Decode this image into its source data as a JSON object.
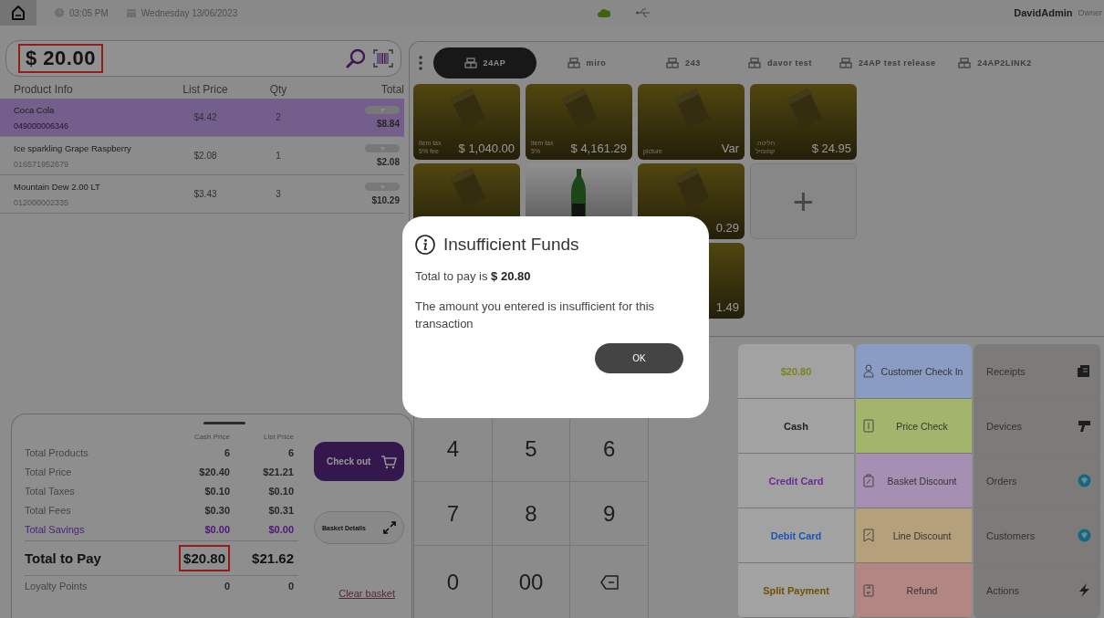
{
  "top_bar": {
    "time": "03:05 PM",
    "date": "Wednesday 13/06/2023",
    "user": "DavidAdmin",
    "role": "Owner"
  },
  "amount_field": {
    "value": "$ 20.00",
    "highlighted": true
  },
  "basket": {
    "columns": [
      "Product Info",
      "List Price",
      "Qty",
      "Total"
    ],
    "rows": [
      {
        "name": "Coca Cola",
        "code": "049000006346",
        "price": "$4.42",
        "qty": "2",
        "total": "$8.84",
        "selected": true
      },
      {
        "name": "Ice sparkling Grape Raspberry",
        "code": "016571952679",
        "price": "$2.08",
        "qty": "1",
        "total": "$2.08",
        "selected": false
      },
      {
        "name": "Mountain Dew 2.00 LT",
        "code": "012000002335",
        "price": "$3.43",
        "qty": "3",
        "total": "$10.29",
        "selected": false
      }
    ]
  },
  "summary": {
    "columns": [
      "Cash Price",
      "List Price"
    ],
    "rows": [
      {
        "kind": "plain",
        "label": "Total Products",
        "cash": "6",
        "list": "6"
      },
      {
        "kind": "plain",
        "label": "Total Price",
        "cash": "$20.40",
        "list": "$21.21"
      },
      {
        "kind": "plain",
        "label": "Total Taxes",
        "cash": "$0.10",
        "list": "$0.10"
      },
      {
        "kind": "plain",
        "label": "Total Fees",
        "cash": "$0.30",
        "list": "$0.31"
      },
      {
        "kind": "savings",
        "label": "Total Savings",
        "cash": "$0.00",
        "list": "$0.00"
      },
      {
        "kind": "total",
        "label": "Total to Pay",
        "cash": "$20.80",
        "list": "$21.62",
        "highlighted": true
      },
      {
        "kind": "plain",
        "label": "Loyalty Points",
        "cash": "0",
        "list": "0"
      }
    ],
    "checkout": "Check out",
    "basket_details": "Basket Details",
    "clear_basket": "Clear basket"
  },
  "categories": [
    {
      "label": "24AP",
      "selected": true
    },
    {
      "label": "miro",
      "selected": false
    },
    {
      "label": "243",
      "selected": false
    },
    {
      "label": "davor test",
      "selected": false
    },
    {
      "label": "24AP test release",
      "selected": false
    },
    {
      "label": "24AP2LINK2",
      "selected": false
    }
  ],
  "tile_rows": [
    [
      {
        "kind": "product",
        "lines": [
          "item tax",
          "5% fee"
        ],
        "price": "$ 1,040.00"
      },
      {
        "kind": "product",
        "lines": [
          "item tax",
          "5%"
        ],
        "price": "$ 4,161.29"
      },
      {
        "kind": "product",
        "lines": [
          "picture"
        ],
        "price": "Var"
      },
      {
        "kind": "product",
        "lines": [
          "חליטה",
          "קמומיל"
        ],
        "price": "$ 24.95"
      }
    ],
    [
      {
        "kind": "product"
      },
      {
        "kind": "bottle"
      },
      {
        "kind": "product",
        "price": "0.29"
      },
      {
        "kind": "add",
        "label": "+"
      }
    ],
    [
      {
        "kind": "blank"
      },
      {
        "kind": "blank"
      },
      {
        "kind": "covered",
        "price": "1.49"
      }
    ]
  ],
  "keypad": [
    [
      {
        "kind": "digit",
        "label": "4"
      },
      {
        "kind": "digit",
        "label": "5"
      },
      {
        "kind": "digit",
        "label": "6"
      }
    ],
    [
      {
        "kind": "digit",
        "label": "7"
      },
      {
        "kind": "digit",
        "label": "8"
      },
      {
        "kind": "digit",
        "label": "9"
      }
    ],
    [
      {
        "kind": "digit",
        "label": "0"
      },
      {
        "kind": "digit",
        "label": "00"
      },
      {
        "kind": "backspace"
      }
    ]
  ],
  "payment_buttons": [
    {
      "label": "$20.80",
      "color": "#7a8414"
    },
    {
      "label": "Cash",
      "color": "#222222"
    },
    {
      "label": "Credit Card",
      "color": "#6a2a96"
    },
    {
      "label": "Debit Card",
      "color": "#1a55b8"
    },
    {
      "label": "Split Payment",
      "color": "#6e5200"
    }
  ],
  "function_buttons": [
    {
      "kind": "checkin",
      "label": "Customer Check In",
      "color": "#8a9cc4"
    },
    {
      "kind": "pricecheck",
      "label": "Price Check",
      "color": "#a3b56c"
    },
    {
      "kind": "basket",
      "label": "Basket Discount",
      "color": "#a58fb3"
    },
    {
      "kind": "line",
      "label": "Line Discount",
      "color": "#b5a07c"
    },
    {
      "kind": "refund",
      "label": "Refund",
      "color": "#b28683"
    }
  ],
  "menu_buttons": [
    {
      "kind": "receipts",
      "label": "Receipts"
    },
    {
      "kind": "devices",
      "label": "Devices"
    },
    {
      "kind": "orders",
      "label": "Orders"
    },
    {
      "kind": "customers",
      "label": "Customers"
    },
    {
      "kind": "actions",
      "label": "Actions"
    }
  ],
  "dialog": {
    "title": "Insufficient Funds",
    "total_line": "Total to pay is **$ 20.80**",
    "message": "The amount you entered is insufficient for this transaction",
    "ok": "OK"
  }
}
